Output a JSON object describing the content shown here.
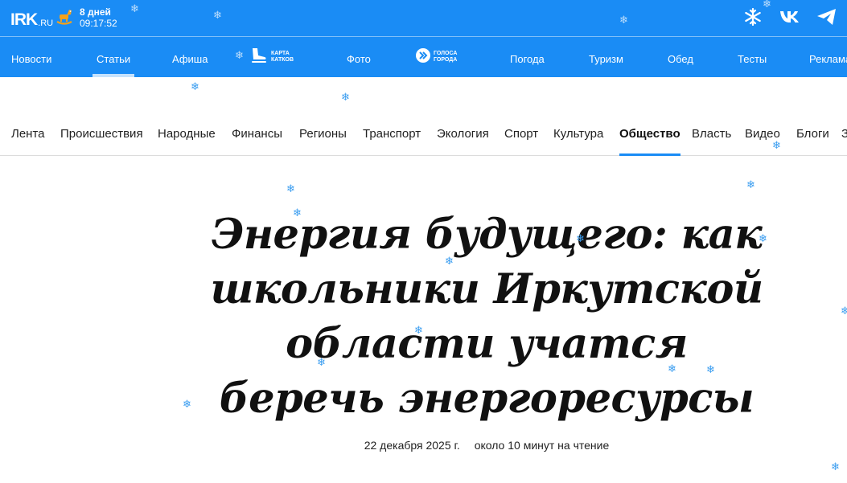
{
  "site": {
    "logo_main": "IRK",
    "logo_suffix": ".RU"
  },
  "countdown": {
    "days": "8 дней",
    "time": "09:17:52"
  },
  "top_icons": [
    "snowflake-icon",
    "vk-icon",
    "telegram-icon"
  ],
  "main_nav": {
    "items": [
      {
        "label": "Новости"
      },
      {
        "label": "Статьи",
        "active": true
      },
      {
        "label": "Афиша"
      },
      {
        "label": "Фото"
      },
      {
        "label": "Погода"
      },
      {
        "label": "Туризм"
      },
      {
        "label": "Обед"
      },
      {
        "label": "Тесты"
      },
      {
        "label": "Реклама"
      }
    ],
    "karta_katkov": {
      "line1": "Карта",
      "line2": "катков"
    },
    "golosa_goroda": {
      "line1": "Голоса",
      "line2": "города"
    }
  },
  "rubrics": {
    "items": [
      {
        "label": "Лента"
      },
      {
        "label": "Происшествия"
      },
      {
        "label": "Народные"
      },
      {
        "label": "Финансы"
      },
      {
        "label": "Регионы"
      },
      {
        "label": "Транспорт"
      },
      {
        "label": "Экология"
      },
      {
        "label": "Спорт"
      },
      {
        "label": "Культура"
      },
      {
        "label": "Общество",
        "active": true
      },
      {
        "label": "Власть"
      },
      {
        "label": "Видео"
      },
      {
        "label": "Блоги"
      },
      {
        "label": "З"
      }
    ]
  },
  "article": {
    "title": "Энергия будущего: как школьники Иркутской области учатся беречь энергоресурсы",
    "date": "22 декабря 2025 г.",
    "reading_time": "около 10 минут на чтение"
  },
  "colors": {
    "brand_blue": "#1a8cf5",
    "active_underline": "#1a8cf5",
    "snowflake": "#3a9df0"
  }
}
